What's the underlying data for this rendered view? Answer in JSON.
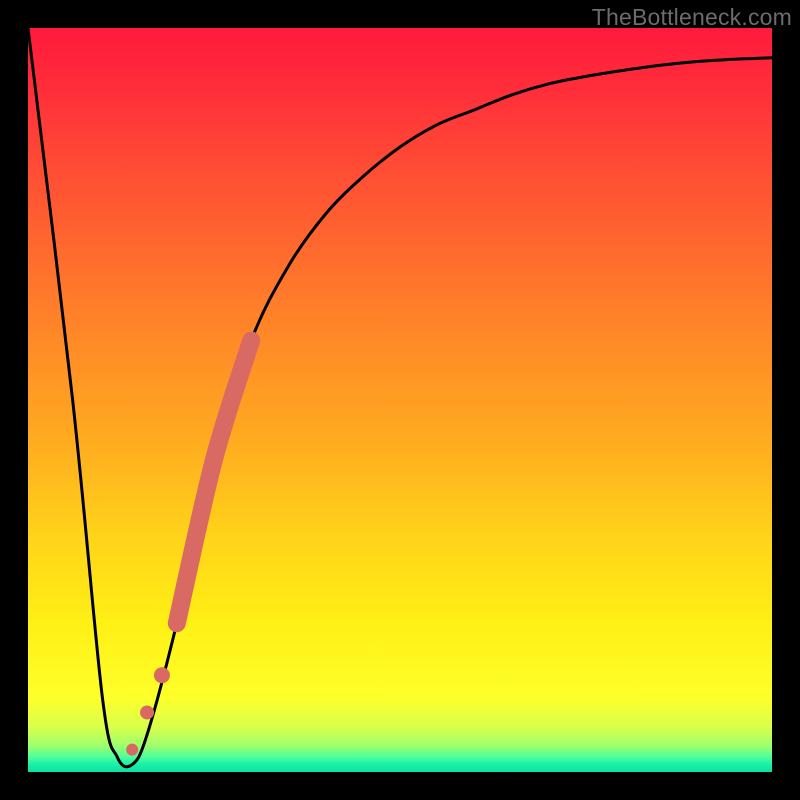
{
  "watermark": "TheBottleneck.com",
  "chart_data": {
    "type": "line",
    "title": "",
    "xlabel": "",
    "ylabel": "",
    "xlim": [
      0,
      100
    ],
    "ylim": [
      0,
      100
    ],
    "grid": false,
    "series": [
      {
        "name": "bottleneck-curve",
        "x": [
          0,
          6,
          10,
          12,
          14,
          16,
          20,
          25,
          30,
          35,
          40,
          45,
          50,
          55,
          60,
          65,
          70,
          75,
          80,
          85,
          90,
          95,
          100
        ],
        "values": [
          100,
          50,
          10,
          2,
          1,
          5,
          20,
          42,
          58,
          68,
          75,
          80,
          84,
          87,
          89,
          91,
          92.5,
          93.5,
          94.3,
          95,
          95.5,
          95.8,
          96
        ]
      },
      {
        "name": "highlight-segment",
        "x": [
          16,
          20,
          25,
          30
        ],
        "values": [
          5,
          20,
          42,
          58
        ]
      }
    ],
    "annotations": []
  },
  "colors": {
    "curve_stroke": "#000000",
    "highlight_stroke": "#d86a63",
    "background_top": "#ff1a3c",
    "background_bottom": "#0ee0a2",
    "frame": "#000000"
  }
}
